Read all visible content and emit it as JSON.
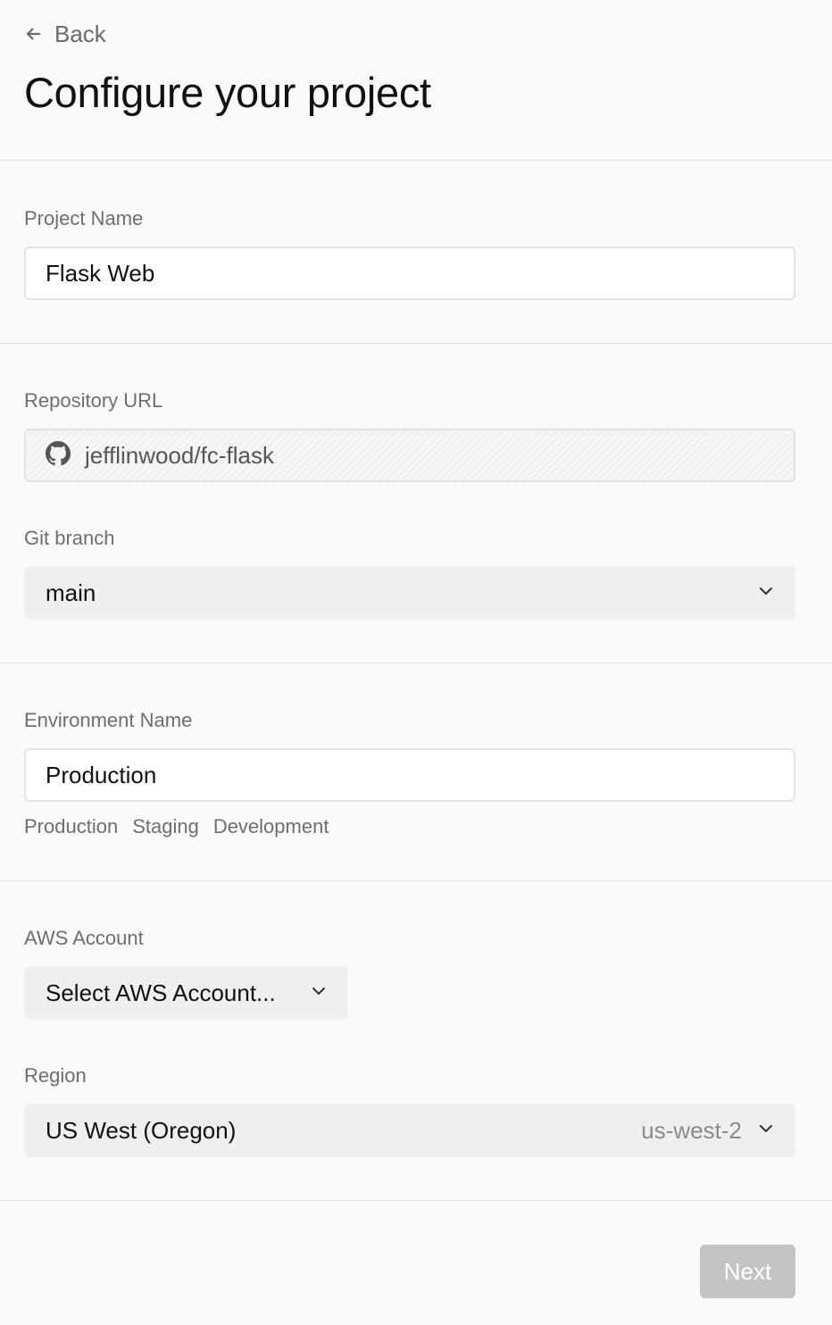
{
  "header": {
    "back_label": "Back",
    "title": "Configure your project"
  },
  "project": {
    "label": "Project Name",
    "value": "Flask Web"
  },
  "repository": {
    "label": "Repository URL",
    "value": "jefflinwood/fc-flask",
    "icon": "github-icon"
  },
  "branch": {
    "label": "Git branch",
    "value": "main"
  },
  "environment": {
    "label": "Environment Name",
    "value": "Production",
    "suggestions": [
      "Production",
      "Staging",
      "Development"
    ]
  },
  "aws_account": {
    "label": "AWS Account",
    "value": "Select AWS Account..."
  },
  "region": {
    "label": "Region",
    "value": "US West (Oregon)",
    "code": "us-west-2"
  },
  "footer": {
    "next_label": "Next"
  },
  "colors": {
    "background": "#fafafa",
    "divider": "#e2e2e2",
    "label_text": "#6e6e6e",
    "select_bg": "#efefef",
    "button_disabled": "#c4c4c4"
  }
}
